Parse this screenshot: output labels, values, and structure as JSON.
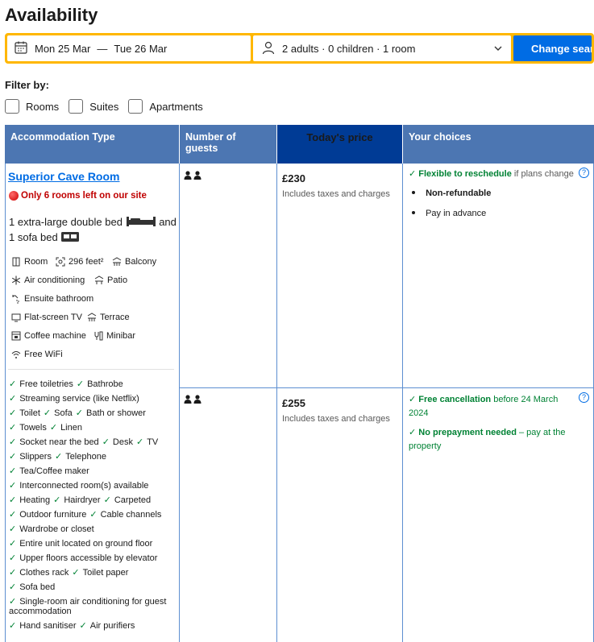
{
  "page": {
    "title": "Availability"
  },
  "search": {
    "check_in": "Mon 25 Mar",
    "separator": "—",
    "check_out": "Tue 26 Mar",
    "guests": "2 adults · 0 children · 1 room",
    "button": "Change search"
  },
  "filter": {
    "label": "Filter by:",
    "options": [
      "Rooms",
      "Suites",
      "Apartments"
    ]
  },
  "table": {
    "headers": {
      "type": "Accommodation Type",
      "guests": "Number of guests",
      "price": "Today's price",
      "choices": "Your choices"
    }
  },
  "room": {
    "name": "Superior Cave Room",
    "scarcity": "Only 6 rooms left on our site",
    "beds_1": "1 extra-large double bed",
    "beds_and": "and",
    "beds_2": "1 sofa bed",
    "facilities": [
      "Room",
      "296 feet²",
      "Balcony",
      "Air conditioning",
      "Patio",
      "Ensuite bathroom",
      "Flat-screen TV",
      "Terrace",
      "Coffee machine",
      "Minibar",
      "Free WiFi"
    ],
    "amenities": [
      [
        "Free toiletries",
        "Bathrobe"
      ],
      [
        "Streaming service (like Netflix)"
      ],
      [
        "Toilet",
        "Sofa",
        "Bath or shower"
      ],
      [
        "Towels",
        "Linen"
      ],
      [
        "Socket near the bed",
        "Desk",
        "TV"
      ],
      [
        "Slippers",
        "Telephone"
      ],
      [
        "Tea/Coffee maker"
      ],
      [
        "Interconnected room(s) available"
      ],
      [
        "Heating",
        "Hairdryer",
        "Carpeted"
      ],
      [
        "Outdoor furniture",
        "Cable channels"
      ],
      [
        "Wardrobe or closet"
      ],
      [
        "Entire unit located on ground floor"
      ],
      [
        "Upper floors accessible by elevator"
      ],
      [
        "Clothes rack",
        "Toilet paper"
      ],
      [
        "Sofa bed"
      ],
      [
        "Single-room air conditioning for guest accommodation"
      ],
      [
        "Hand sanitiser",
        "Air purifiers"
      ]
    ]
  },
  "options": [
    {
      "price": "£230",
      "price_note": "Includes taxes and charges",
      "choice_1_bold": "Flexible to reschedule",
      "choice_1_rest": "if plans change",
      "choice_2": "Non-refundable",
      "choice_3": "Pay in advance"
    },
    {
      "price": "£255",
      "price_note": "Includes taxes and charges",
      "choice_1_bold": "Free cancellation",
      "choice_1_rest": "before 24 March 2024",
      "choice_2_bold": "No prepayment needed",
      "choice_2_rest": "– pay at the property"
    }
  ],
  "colors": {
    "header_blue": "#4c76b2",
    "header_dark": "#003b95",
    "accent": "#006ce4",
    "yellow": "#ffb700",
    "green": "#008234",
    "red": "#c00000"
  }
}
